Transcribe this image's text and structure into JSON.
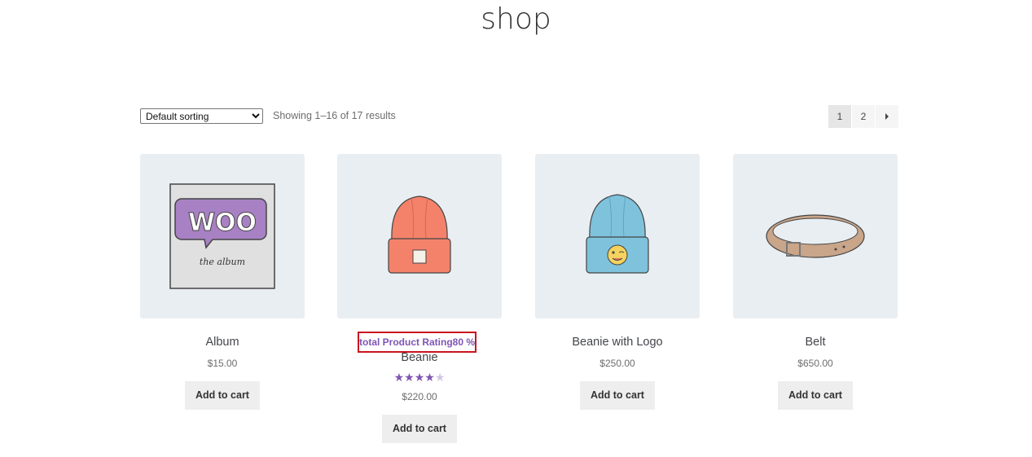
{
  "page": {
    "title": "shop"
  },
  "toolbar": {
    "sort_selected": "Default sorting",
    "result_count": "Showing 1–16 of 17 results"
  },
  "pagination": {
    "pages": [
      "1",
      "2"
    ],
    "current": "1",
    "next_icon": "caret-right-icon"
  },
  "products": [
    {
      "name": "Album",
      "price": "$15.00",
      "button": "Add to cart"
    },
    {
      "name": "Beanie",
      "price": "$220.00",
      "button": "Add to cart",
      "rating_label": "total Product Rating80 %",
      "rating": 0.8
    },
    {
      "name": "Beanie with Logo",
      "price": "$250.00",
      "button": "Add to cart"
    },
    {
      "name": "Belt",
      "price": "$650.00",
      "button": "Add to cart"
    }
  ],
  "colors": {
    "accent": "#7f54b3",
    "highlight_border": "#c9151e",
    "card_bg": "#e9eef2"
  },
  "images": {
    "album_text_1": "WOO",
    "album_text_2": "the album"
  }
}
